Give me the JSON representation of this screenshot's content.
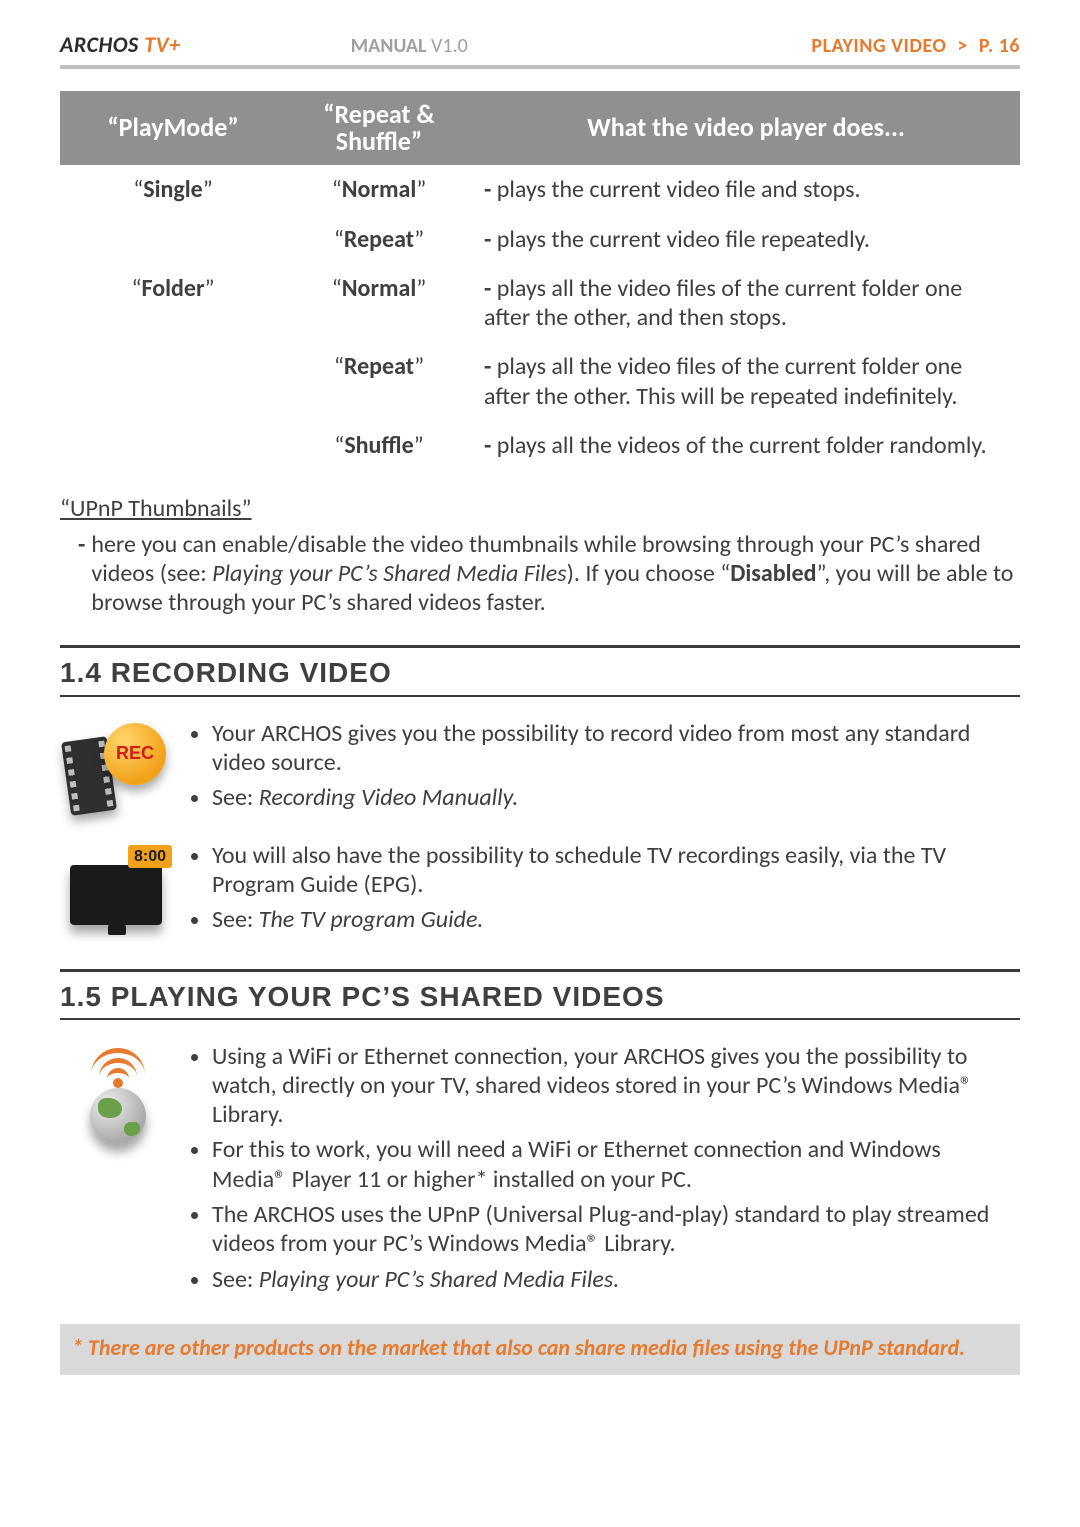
{
  "brand": {
    "name": "ARCHOS",
    "suffix": " TV+"
  },
  "header": {
    "manual_label": "MANUAL",
    "manual_version": " V1.0",
    "crumb_section": "PLAYING VIDEO",
    "crumb_sep": ">",
    "crumb_page": "P. 16"
  },
  "table": {
    "head": {
      "col1": "“PlayMode”",
      "col2": "“Repeat & Shuffle”",
      "col3": "What the video player does..."
    },
    "rows": [
      {
        "mode": "Single",
        "rs": "Normal",
        "desc": "plays the current video file and stops."
      },
      {
        "mode": "",
        "rs": "Repeat",
        "desc": "plays the current video file repeatedly."
      },
      {
        "mode": "Folder",
        "rs": "Normal",
        "desc": "plays all the video files of the current folder one after the other, and then stops."
      },
      {
        "mode": "",
        "rs": "Repeat",
        "desc": "plays all the video files of the current folder one after the other. This will be repeated indefinitely."
      },
      {
        "mode": "",
        "rs": "Shuffle",
        "desc": "plays all the videos of the current folder randomly."
      }
    ]
  },
  "upnp": {
    "title": "“UPnP Thumbnails”",
    "text_pre": "here you can enable/disable the video thumbnails while browsing through your PC’s shared videos (see: ",
    "text_ital": "Playing your PC’s Shared Media Files",
    "text_mid": "). If you choose “",
    "text_bold": "Disabled",
    "text_post": "”, you will be able to browse through your PC’s shared videos faster."
  },
  "sec14": {
    "title": "1.4  RECORDING VIDEO",
    "rec_label": "REC",
    "bullets1": [
      "Your ARCHOS gives you the possibility to record video from most any standard video source."
    ],
    "see1_label": "See: ",
    "see1_ital": "Recording Video Manually.",
    "tv_badge": "8:00",
    "bullets2": [
      "You will also have the possibility to schedule TV recordings easily, via the TV Program Guide (EPG)."
    ],
    "see2_label": "See: ",
    "see2_ital": "The TV program Guide."
  },
  "sec15": {
    "title": "1.5 PLAYING YOUR PC’S SHARED VIDEOS",
    "bullets": [
      "Using a WiFi or Ethernet connection, your ARCHOS gives you the possibility to watch, directly on your TV, shared videos stored in your PC’s Windows Media® Library.",
      "For this to work, you will need a WiFi or Ethernet connection and Windows Media® Player 11 or higher* installed on your PC.",
      "The ARCHOS uses the UPnP (Universal Plug-and-play) standard to play streamed videos from your PC’s Windows Media® Library."
    ],
    "see_label": "See: ",
    "see_ital": "Playing your PC’s Shared Media Files."
  },
  "footnote": "* There are other products on the market that also can share media files using the UPnP standard."
}
